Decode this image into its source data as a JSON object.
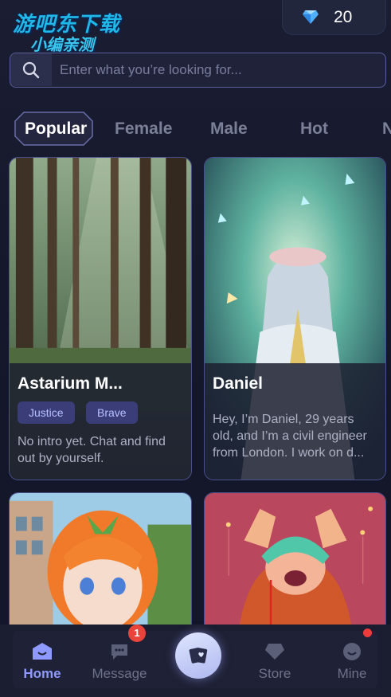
{
  "watermark": {
    "line1": "游吧东下载",
    "line2": "小编亲测",
    "ghost": "i"
  },
  "wallet": {
    "diamonds": "20",
    "icon": "diamond-icon"
  },
  "search": {
    "placeholder": "Enter what you’re looking for..."
  },
  "tabs": [
    {
      "label": "Popular",
      "active": true
    },
    {
      "label": "Female"
    },
    {
      "label": "Male"
    },
    {
      "label": "Hot"
    },
    {
      "label": "N"
    }
  ],
  "cards": [
    {
      "title": "Astarium M...",
      "tags": [
        "Justice",
        "Brave"
      ],
      "description": [
        "No intro yet. Chat and find",
        "out by yourself."
      ]
    },
    {
      "title": "Daniel",
      "tags": [],
      "description": [
        "Hey, I’m Daniel, 29 years",
        "old, and I’m a civil engineer",
        "from London. I work on d..."
      ]
    },
    {
      "title": "",
      "tags": [],
      "description": []
    },
    {
      "title": "",
      "tags": [],
      "description": []
    }
  ],
  "nav": {
    "home": "Home",
    "message": "Message",
    "message_badge": "1",
    "store": "Store",
    "mine": "Mine"
  },
  "colors": {
    "accent": "#8e9aff",
    "background": "#15172a",
    "badge": "#e8443b"
  }
}
